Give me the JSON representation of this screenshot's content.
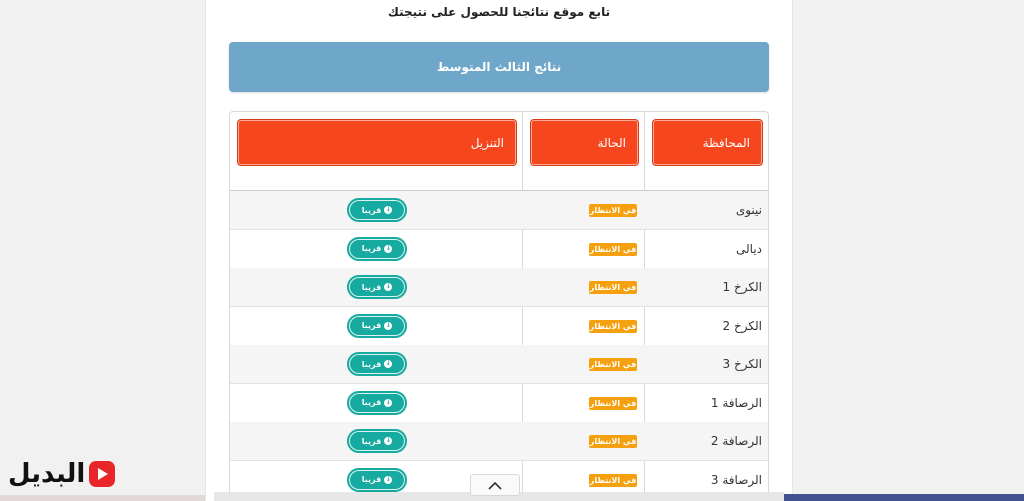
{
  "headline": "تابع موقع نتائجنا للحصول على نتيجتك",
  "banner": "نتائج الثالث المتوسط",
  "table": {
    "headers": {
      "province": "المحافظة",
      "status": "الحالة",
      "download": "التنزيل"
    },
    "rows": [
      {
        "province": "نينوى",
        "status": "في الانتظار",
        "download": "قريبا"
      },
      {
        "province": "ديالى",
        "status": "في الانتظار",
        "download": "قريبا"
      },
      {
        "province": "الكرخ 1",
        "status": "في الانتظار",
        "download": "قريبا"
      },
      {
        "province": "الكرخ 2",
        "status": "في الانتظار",
        "download": "قريبا"
      },
      {
        "province": "الكرخ 3",
        "status": "في الانتظار",
        "download": "قريبا"
      },
      {
        "province": "الرصافة 1",
        "status": "في الانتظار",
        "download": "قريبا"
      },
      {
        "province": "الرصافة 2",
        "status": "في الانتظار",
        "download": "قريبا"
      },
      {
        "province": "الرصافة 3",
        "status": "في الانتظار",
        "download": "قريبا"
      }
    ]
  },
  "logo": {
    "text": "البديل",
    "icon": "play-icon"
  },
  "scroll_top_icon": "chevron-up-icon",
  "colors": {
    "banner": "#6ea7c9",
    "header_button": "#f5461d",
    "badge": "#f5a10f",
    "download_button": "#17aaa0",
    "logo_red": "#e8262a"
  }
}
